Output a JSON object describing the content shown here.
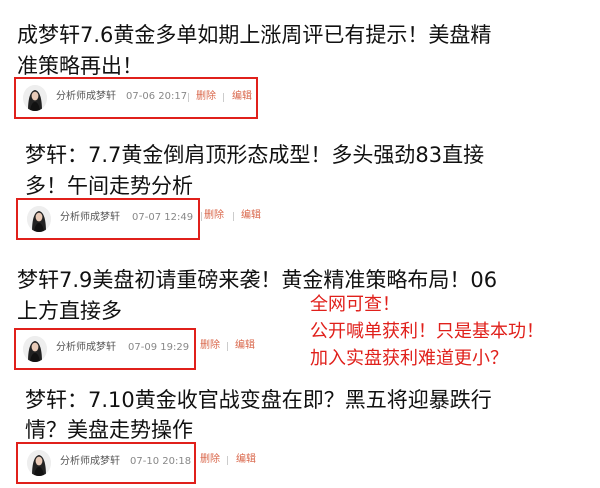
{
  "posts": [
    {
      "title_line1": "成梦轩7.6黄金多单如期上涨周评已有提示！美盘精",
      "title_line2": "准策略再出！",
      "author": "分析师成梦轩",
      "time": "07-06 20:17",
      "delete_label": "删除",
      "edit_label": "编辑"
    },
    {
      "title_line1": "梦轩：7.7黄金倒肩顶形态成型！多头强劲83直接",
      "title_line2": "多！午间走势分析",
      "author": "分析师成梦轩",
      "time": "07-07 12:49",
      "delete_label": "删除",
      "edit_label": "编辑"
    },
    {
      "title_line1": "梦轩7.9美盘初请重磅来袭！黄金精准策略布局！06",
      "title_line2": "上方直接多",
      "author": "分析师成梦轩",
      "time": "07-09 19:29",
      "delete_label": "删除",
      "edit_label": "编辑"
    },
    {
      "title_line1": "梦轩：7.10黄金收官战变盘在即？黑五将迎暴跌行",
      "title_line2": "情？美盘走势操作",
      "author": "分析师成梦轩",
      "time": "07-10 20:18",
      "delete_label": "删除",
      "edit_label": "编辑"
    }
  ],
  "annotation": {
    "line1": "全网可查！",
    "line2": "公开喊单获利！只是基本功！",
    "line3": "加入实盘获利难道更小？"
  },
  "colors": {
    "highlight_border": "#e0201b",
    "annotation_text": "#e0201b",
    "action_link": "#d9664a"
  }
}
